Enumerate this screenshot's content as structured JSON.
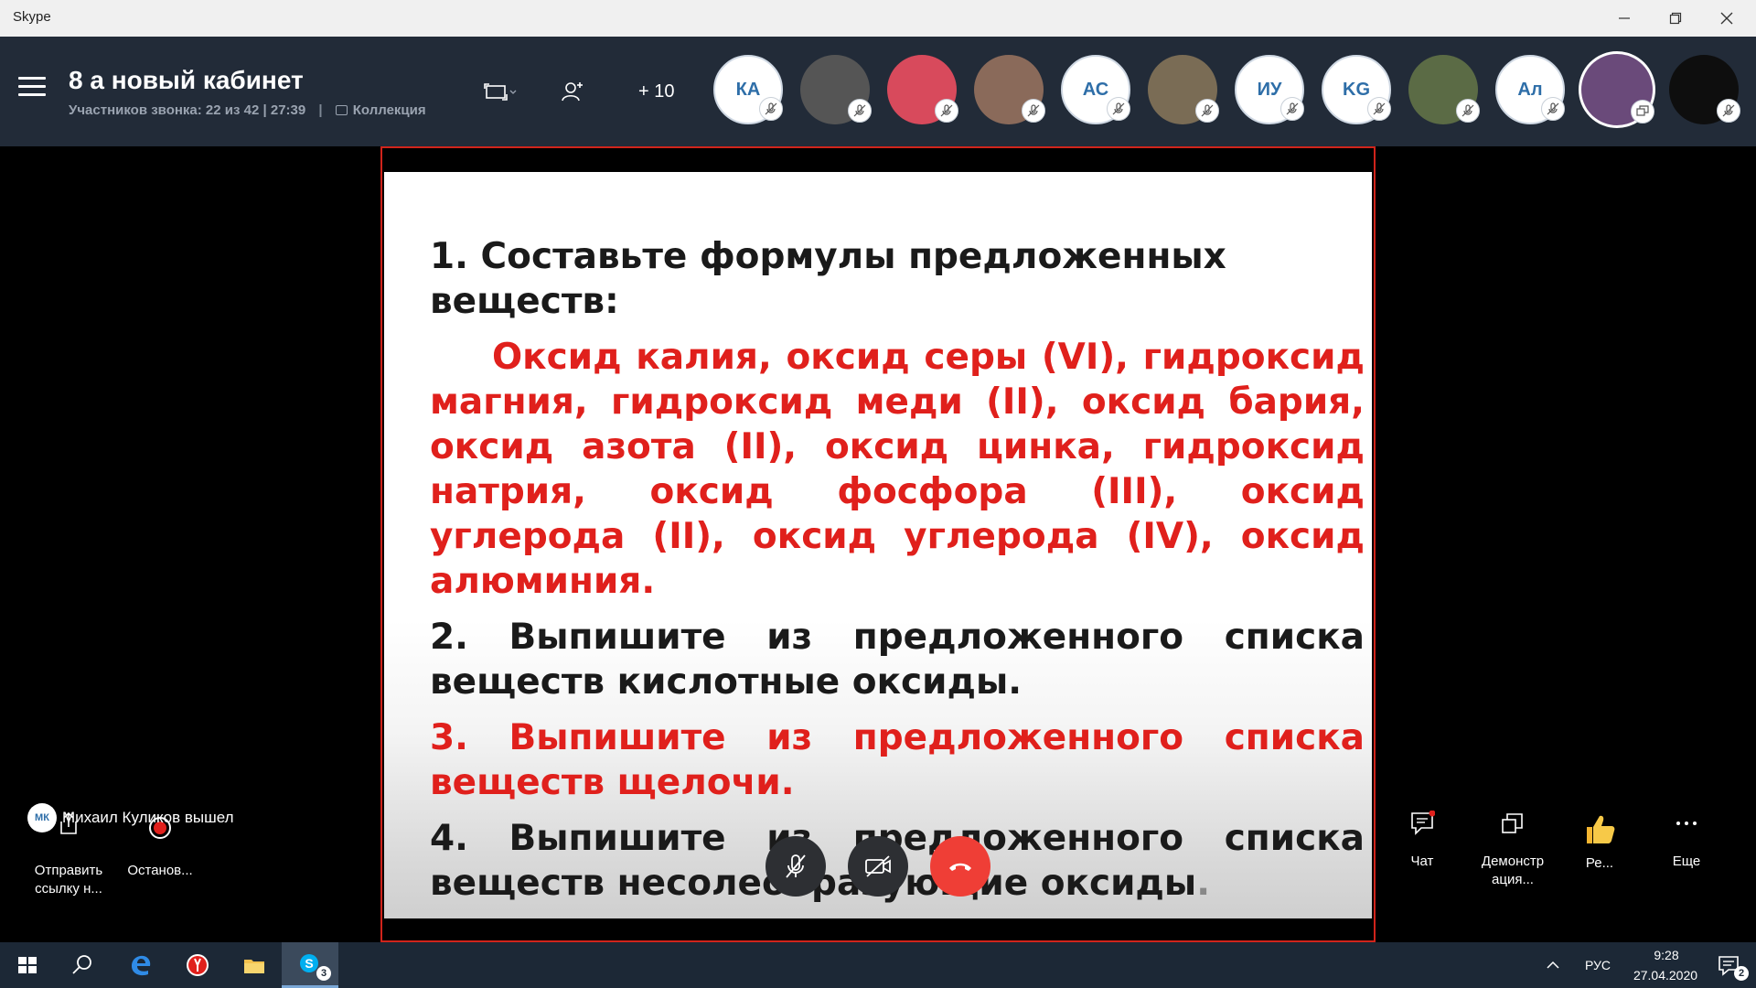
{
  "window": {
    "title": "Skype",
    "minimize_icon": "minimize-icon",
    "maximize_icon": "restore-icon",
    "close_icon": "close-icon"
  },
  "call": {
    "title": "8 а новый кабинет",
    "participants_text": "Участников звонка: 22 из 42",
    "duration": "27:39",
    "divider": "|",
    "gallery_label": "Коллекция",
    "add_count": "+ 10"
  },
  "participants": [
    {
      "initials": "КА",
      "type": "initials"
    },
    {
      "initials": "",
      "type": "photo",
      "color": "#555555"
    },
    {
      "initials": "",
      "type": "photo",
      "color": "#d84a5c"
    },
    {
      "initials": "",
      "type": "photo",
      "color": "#8a6a5a"
    },
    {
      "initials": "АС",
      "type": "initials"
    },
    {
      "initials": "",
      "type": "photo",
      "color": "#7a6c55"
    },
    {
      "initials": "ИУ",
      "type": "initials"
    },
    {
      "initials": "KG",
      "type": "initials"
    },
    {
      "initials": "",
      "type": "photo",
      "color": "#5b6b45"
    },
    {
      "initials": "Ал",
      "type": "initials"
    },
    {
      "initials": "",
      "type": "photo",
      "color": "#6a4a7a"
    },
    {
      "initials": "",
      "type": "photo",
      "color": "#0e0e0e"
    }
  ],
  "slide": {
    "task1_title": "1. Составьте формулы предложенных веществ:",
    "task1_body": "Оксид калия, оксид серы (VI), гидроксид магния, гидроксид меди (II), оксид бария, оксид азота (II), оксид цинка, гидроксид натрия, оксид фосфора (III), оксид углерода (II), оксид углерода (IV), оксид алюминия.",
    "task2": "2. Выпишите из предложенного списка веществ кислотные оксиды.",
    "task3": "3. Выпишите из предложенного списка веществ щелочи.",
    "task4": "4. Выпишите из предложенного списка веществ несолеобразующие оксиды",
    "task4_dot": "."
  },
  "left_panel": {
    "share_link_label": "Отправить ссылку н...",
    "record_label": "Останов...",
    "notification_initials": "МК",
    "notification_text": "Михаил Куликов вышел"
  },
  "right_panel": {
    "chat_label": "Чат",
    "share_screen_label": "Демонстр ация...",
    "react_label": "Ре...",
    "more_label": "Еще"
  },
  "colors": {
    "header_bg": "#222b38",
    "slide_red": "#e0201c",
    "share_border": "#d0241b",
    "end_call": "#ef3e36",
    "taskbar_bg": "#1c2836"
  },
  "taskbar": {
    "language": "РУС",
    "time": "9:28",
    "date": "27.04.2020",
    "skype_badge": "3",
    "notification_count": "2"
  }
}
